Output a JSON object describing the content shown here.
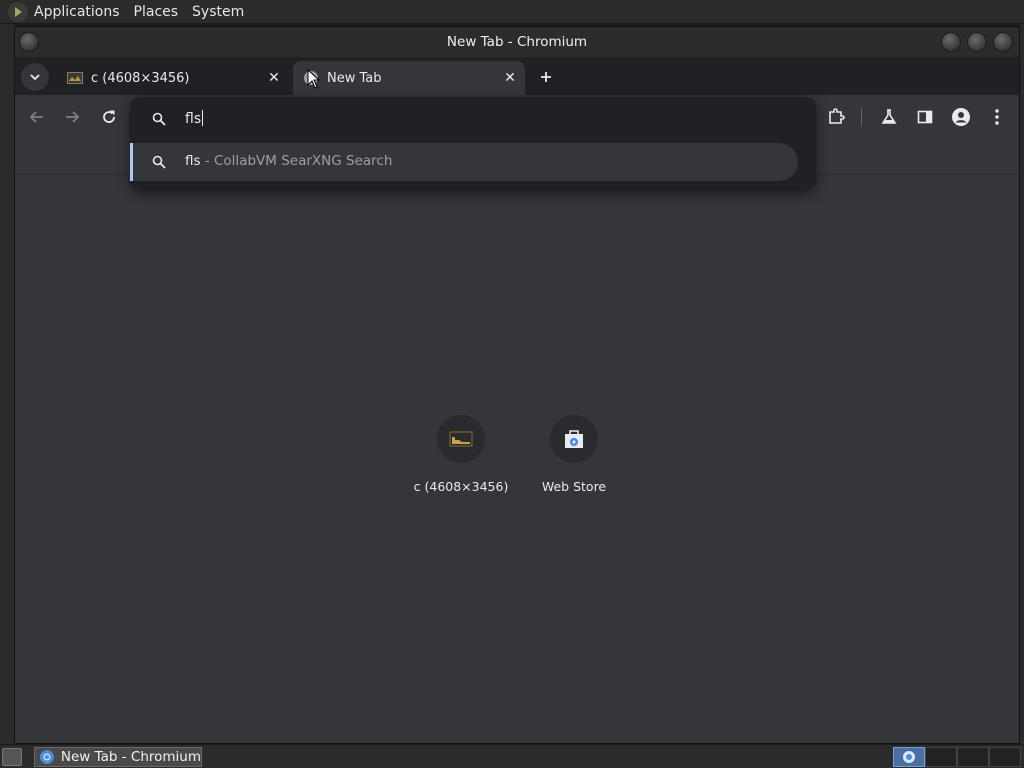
{
  "top_panel": {
    "menus": [
      "Applications",
      "Places",
      "System"
    ]
  },
  "window": {
    "title": "New Tab - Chromium"
  },
  "tabs": [
    {
      "label": "c (4608×3456)",
      "active": false,
      "favicon": "image-thumbnail-icon"
    },
    {
      "label": "New Tab",
      "active": true,
      "favicon": "chromium-globe-icon"
    }
  ],
  "toolbar": {
    "icons": [
      "back-arrow-icon",
      "forward-arrow-icon",
      "reload-icon",
      "extensions-icon",
      "labs-flask-icon",
      "side-panel-icon",
      "profile-icon",
      "menu-kebab-icon"
    ]
  },
  "omnibox": {
    "input_value": "fls",
    "suggestion": {
      "query": "fls",
      "description": " - CollabVM SearXNG Search"
    }
  },
  "shortcuts": [
    {
      "label": "c (4608×3456)",
      "icon": "image-thumbnail-icon"
    },
    {
      "label": "Web Store",
      "icon": "web-store-icon"
    }
  ],
  "taskbar": {
    "task_label": "New Tab - Chromium"
  },
  "colors": {
    "accent": "#a8c7fa",
    "content_bg": "#35363a",
    "popup_bg": "#202124"
  }
}
